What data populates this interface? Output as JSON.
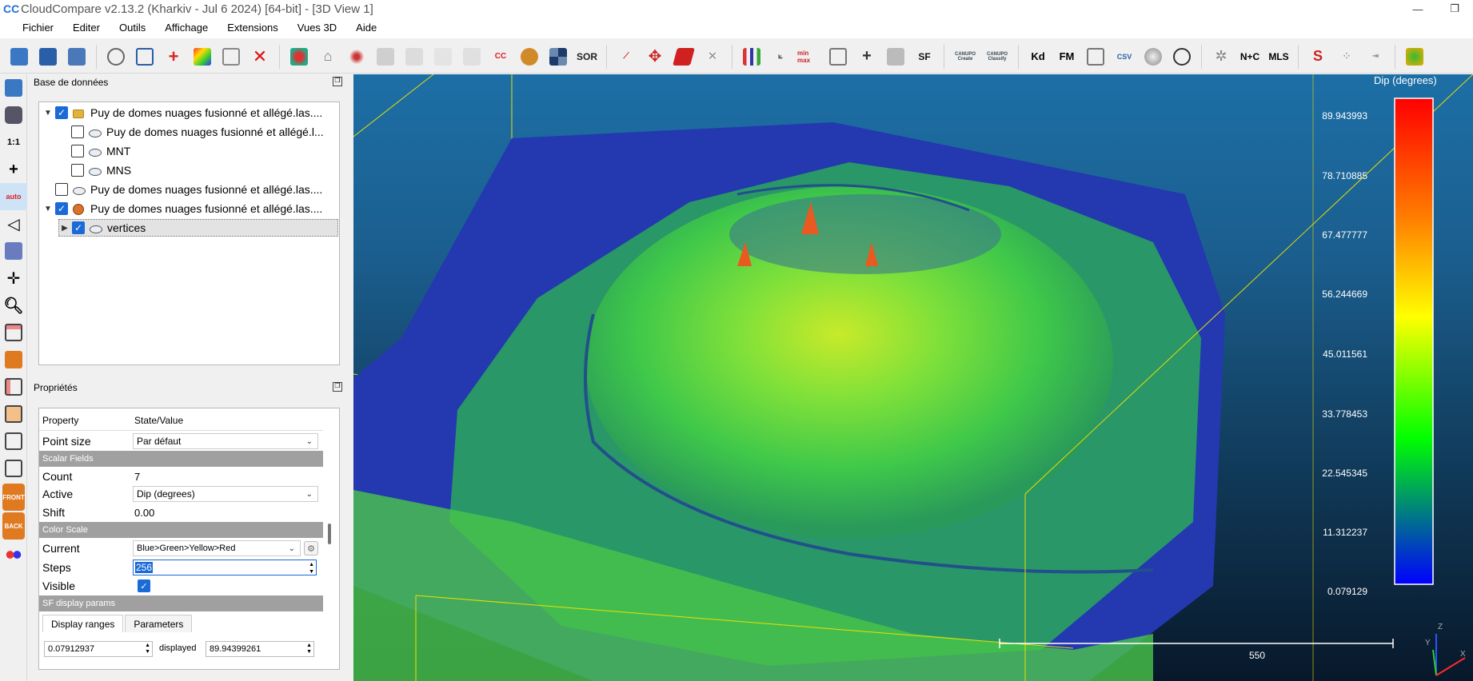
{
  "window": {
    "title": "CloudCompare v2.13.2 (Kharkiv - Jul  6 2024) [64-bit] - [3D View 1]",
    "app_icon": "CC",
    "controls": [
      "—",
      "❐"
    ]
  },
  "menu": [
    "Fichier",
    "Editer",
    "Outils",
    "Affichage",
    "Extensions",
    "Vues 3D",
    "Aide"
  ],
  "toolbar": {
    "sor_label": "SOR",
    "sf_label": "SF",
    "canupo_create": "CANUPO Create",
    "canupo_classify": "CANUPO Classify",
    "kd_label": "Kd",
    "fm_label": "FM",
    "csv_label": "CSV",
    "mls_label": "MLS",
    "nc_label": "N+C",
    "minmax_label": "min max"
  },
  "vtoolbar": {
    "one_to_one": "1:1",
    "auto": "auto",
    "front": "FRONT",
    "back": "BACK"
  },
  "db_panel": {
    "title": "Base de données",
    "items": [
      {
        "label": "Puy de domes nuages fusionné et allégé.las....",
        "checked": true
      },
      {
        "label": "Puy de domes nuages fusionné et allégé.l...",
        "checked": false
      },
      {
        "label": "MNT",
        "checked": false
      },
      {
        "label": "MNS",
        "checked": false
      },
      {
        "label": "Puy de domes nuages fusionné et allégé.las....",
        "checked": false
      },
      {
        "label": "Puy de domes nuages fusionné et allégé.las....",
        "checked": true
      },
      {
        "label": "vertices",
        "checked": true
      }
    ]
  },
  "props_panel": {
    "title": "Propriétés",
    "header": {
      "property": "Property",
      "value": "State/Value"
    },
    "point_size": {
      "label": "Point size",
      "value": "Par défaut"
    },
    "scalar_fields_section": "Scalar Fields",
    "count": {
      "label": "Count",
      "value": "7"
    },
    "active": {
      "label": "Active",
      "value": "Dip (degrees)"
    },
    "shift": {
      "label": "Shift",
      "value": "0.00"
    },
    "color_scale_section": "Color Scale",
    "current": {
      "label": "Current",
      "value": "Blue>Green>Yellow>Red"
    },
    "steps": {
      "label": "Steps",
      "value": "256"
    },
    "visible": {
      "label": "Visible",
      "checked": true
    },
    "sf_display_section": "SF display params",
    "tabs": [
      "Display ranges",
      "Parameters"
    ],
    "range_min": "0.07912937",
    "displayed_label": "displayed",
    "range_max": "89.94399261"
  },
  "view3d": {
    "colorbar": {
      "title": "Dip (degrees)",
      "ticks": [
        "89.943993",
        "78.710885",
        "67.477777",
        "56.244669",
        "45.011561",
        "33.778453",
        "22.545345",
        "11.312237",
        "0.079129"
      ],
      "colors": [
        "#ff0000",
        "#ff8000",
        "#ffff00",
        "#00ff00",
        "#0000ff"
      ]
    },
    "scale_bar_label": "550",
    "axes": {
      "z": "Z",
      "y": "Y",
      "x": "X"
    }
  },
  "colors": {
    "accent": "#1a6ad8",
    "bbox": "#e8e000",
    "terrain_low": "#1a2fb0",
    "terrain_mid": "#33d14a",
    "terrain_high": "#e8f020"
  }
}
